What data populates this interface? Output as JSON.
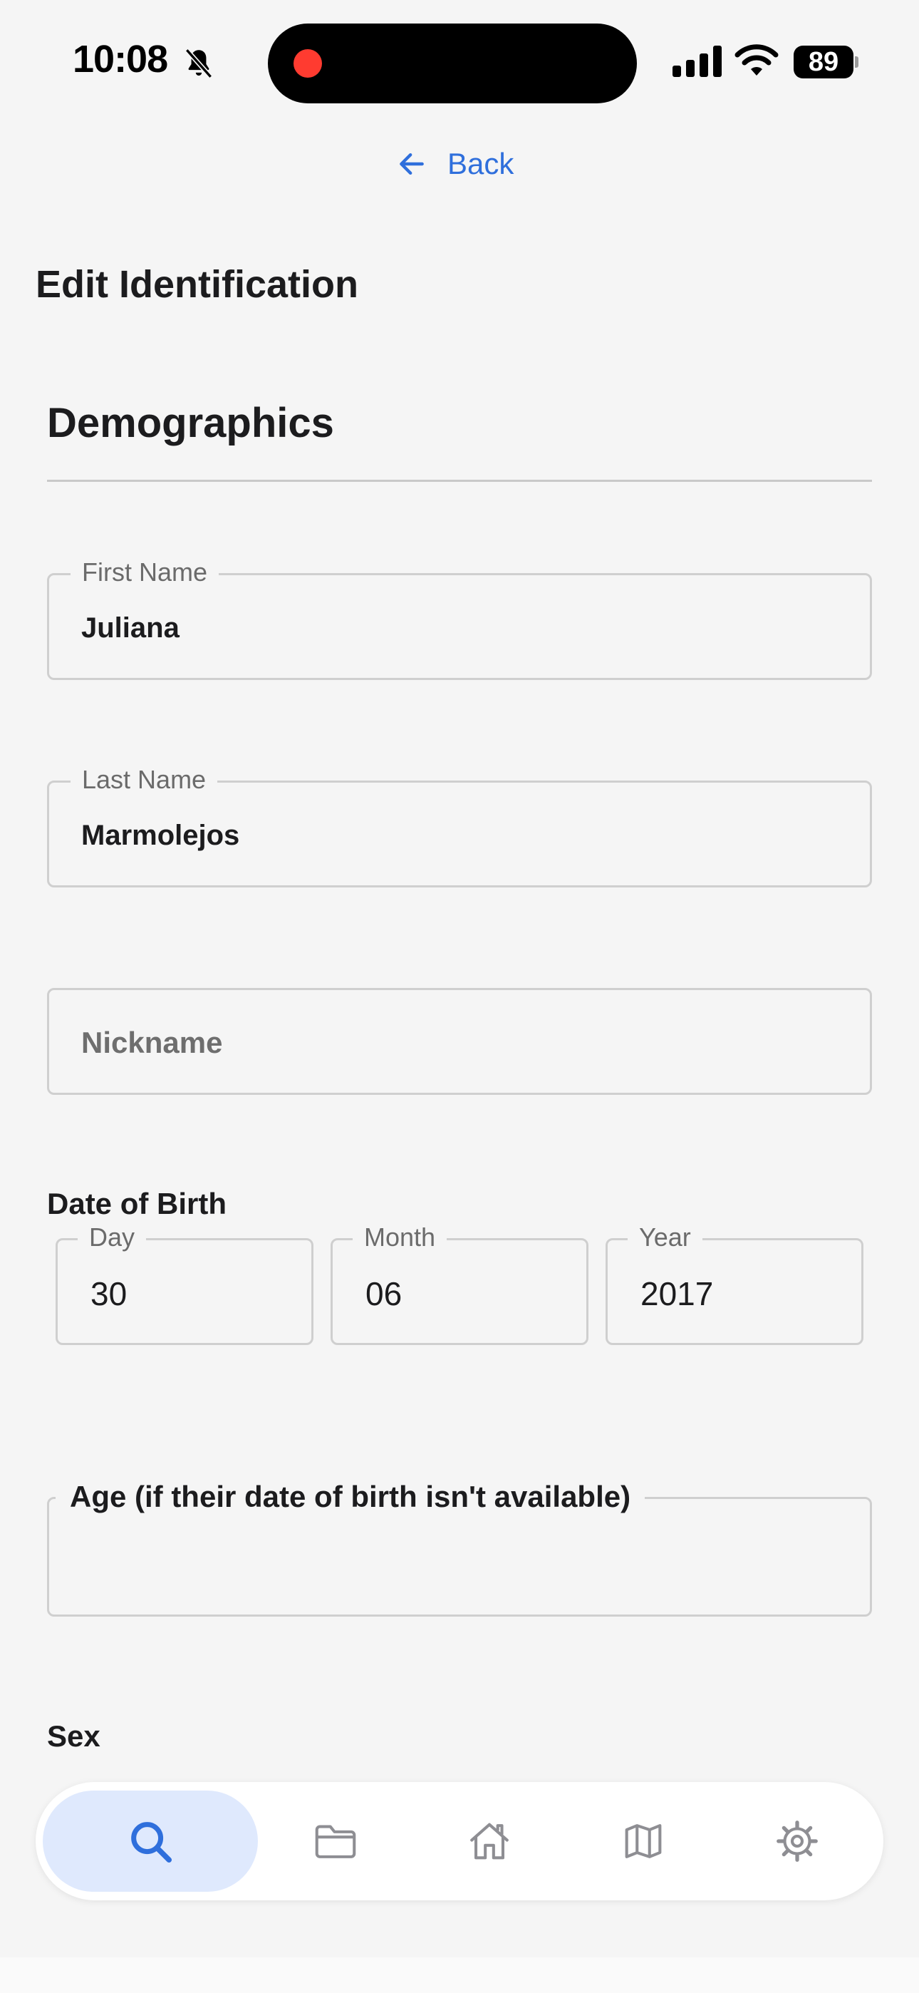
{
  "status_bar": {
    "time": "10:08",
    "battery": "89",
    "icons": [
      "bell-slash-icon",
      "signal-icon",
      "wifi-icon",
      "battery-icon"
    ]
  },
  "nav": {
    "back_label": "Back"
  },
  "page": {
    "title": "Edit Identification"
  },
  "section": {
    "title": "Demographics"
  },
  "fields": {
    "first_name": {
      "label": "First Name",
      "value": "Juliana"
    },
    "last_name": {
      "label": "Last Name",
      "value": "Marmolejos"
    },
    "nickname": {
      "placeholder": "Nickname",
      "value": ""
    }
  },
  "dob": {
    "label": "Date of Birth",
    "day": {
      "label": "Day",
      "value": "30"
    },
    "month": {
      "label": "Month",
      "value": "06"
    },
    "year": {
      "label": "Year",
      "value": "2017"
    }
  },
  "age": {
    "label": "Age (if their date of birth isn't available)",
    "value": ""
  },
  "sex": {
    "label": "Sex"
  },
  "tabbar": {
    "accent": "#2f6fdc",
    "active_bg": "#dfe9fd",
    "tabs": [
      {
        "icon": "search-icon",
        "active": true
      },
      {
        "icon": "folder-icon",
        "active": false
      },
      {
        "icon": "home-icon",
        "active": false
      },
      {
        "icon": "map-icon",
        "active": false
      },
      {
        "icon": "gear-icon",
        "active": false
      }
    ]
  }
}
